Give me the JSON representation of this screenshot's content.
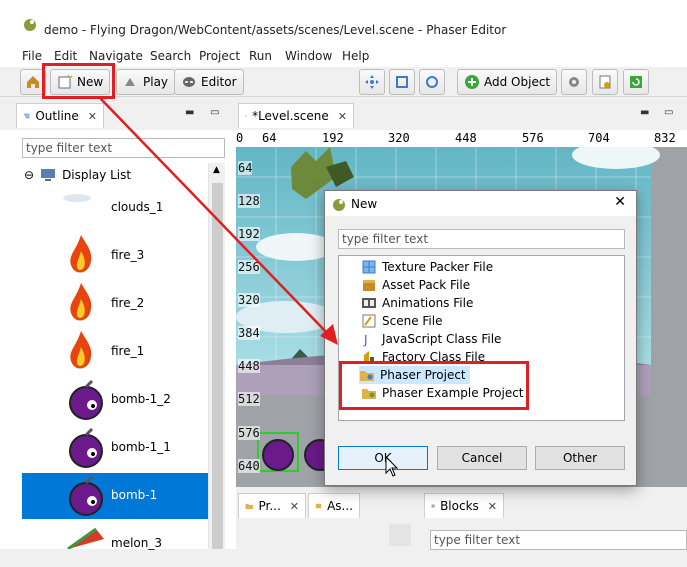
{
  "window": {
    "title": "demo - Flying Dragon/WebContent/assets/scenes/Level.scene - Phaser Editor"
  },
  "menu": [
    "File",
    "Edit",
    "Navigate",
    "Search",
    "Project",
    "Run",
    "Window",
    "Help"
  ],
  "toolbar": {
    "new_label": "New",
    "play_label": "Play",
    "editor_label": "Editor",
    "add_object_label": "Add Object"
  },
  "outline": {
    "tab_label": "Outline",
    "filter_placeholder": "type filter text",
    "root_label": "Display List",
    "items": [
      "clouds_1",
      "fire_3",
      "fire_2",
      "fire_1",
      "bomb-1_2",
      "bomb-1_1",
      "bomb-1",
      "melon_3"
    ]
  },
  "editor": {
    "tab_label": "*Level.scene",
    "ruler_x": [
      "0",
      "64",
      "192",
      "320",
      "448",
      "576",
      "704",
      "832"
    ],
    "ruler_y": [
      "64",
      "128",
      "192",
      "256",
      "320",
      "384",
      "448",
      "512",
      "576",
      "640"
    ]
  },
  "dialog": {
    "title": "New",
    "filter_placeholder": "type filter text",
    "items": [
      "Texture Packer File",
      "Asset Pack File",
      "Animations File",
      "Scene File",
      "JavaScript Class File",
      "Factory Class File",
      "Phaser Project",
      "Phaser Example Project"
    ],
    "selected": "Phaser Project",
    "ok_label": "OK",
    "cancel_label": "Cancel",
    "other_label": "Other"
  },
  "bottom": {
    "tab1_label": "Pr...",
    "tab2_label": "As...",
    "tab3_label": "Blocks",
    "filter_placeholder": "type filter text"
  },
  "colors": {
    "accent": "#0078d7",
    "highlight": "#e02020",
    "selection": "#cce8ff"
  }
}
